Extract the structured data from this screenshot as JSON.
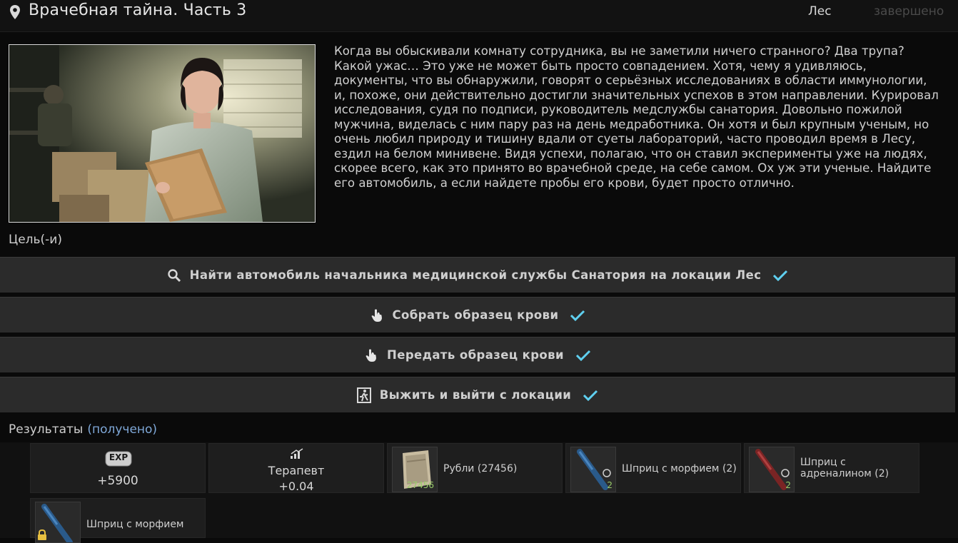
{
  "header": {
    "title": "Врачебная тайна. Часть 3",
    "location": "Лес",
    "status": "завершено"
  },
  "description": "Когда вы обыскивали комнату сотрудника, вы не заметили ничего странного? Два трупа? Какой ужас… Это уже не может быть просто совпадением. Хотя, чему я удивляюсь, документы, что вы обнаружили, говорят о серьёзных исследованиях в области иммунологии, и, похоже, они действительно достигли значительных успехов в этом направлении. Курировал исследования, судя по подписи, руководитель медслужбы санатория. Довольно пожилой мужчина, виделась с ним пару раз на день медработника. Он хотя и был крупным ученым, но очень любил природу и тишину вдали от суеты лабораторий, часто проводил время в Лесу, ездил на белом минивене. Видя успехи, полагаю, что он ставил эксперименты уже на людях, скорее всего, как это принято во врачебной среде, на себе самом. Ох уж эти ученые. Найдите его автомобиль, а если найдете пробы его крови, будет просто отлично.",
  "goals_label": "Цель(-и)",
  "objectives": [
    {
      "text": "Найти автомобиль начальника медицинской службы Санатория на локации Лес",
      "icon": "search-icon"
    },
    {
      "text": "Собрать образец крови",
      "icon": "hand-pointer-icon"
    },
    {
      "text": "Передать образец крови",
      "icon": "hand-pointer-icon"
    },
    {
      "text": "Выжить и выйти с локации",
      "icon": "exit-icon"
    }
  ],
  "results": {
    "label": "Результаты",
    "status": "(получено)"
  },
  "rewards": {
    "exp": {
      "badge": "EXP",
      "value": "+5900"
    },
    "skill": {
      "name": "Терапевт",
      "value": "+0.04"
    },
    "items": [
      {
        "name": "Рубли (27456)",
        "count": "27456"
      },
      {
        "name": "Шприц с морфием (2)",
        "count": "2"
      },
      {
        "name": "Шприц с адреналином (2)",
        "count": "2"
      },
      {
        "name": "Шприц с морфием",
        "count": ""
      }
    ]
  },
  "colors": {
    "accent_check": "#5fd0f0",
    "received": "#7fa8d8"
  }
}
